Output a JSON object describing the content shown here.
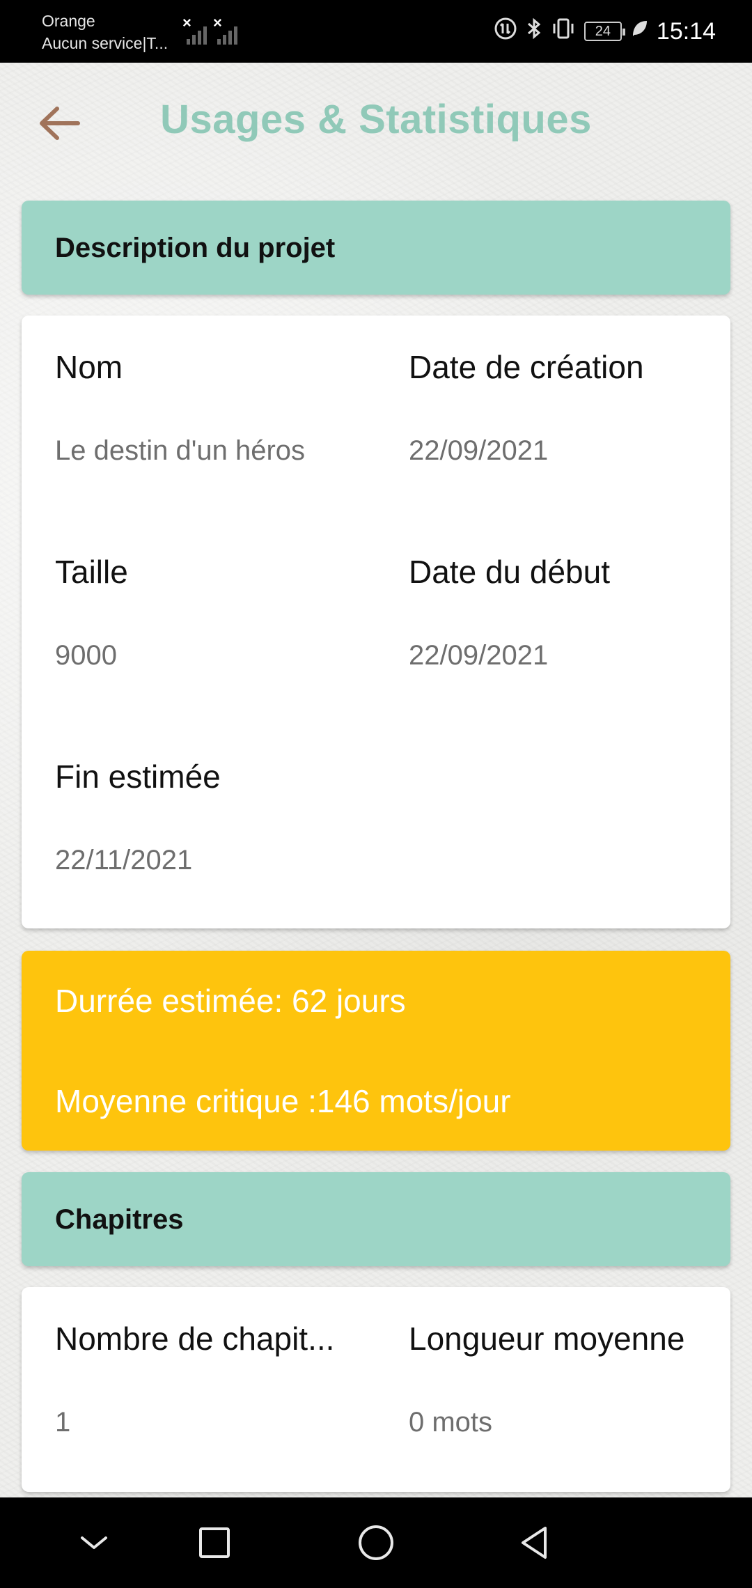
{
  "status_bar": {
    "carrier_name": "Orange",
    "carrier_status": "Aucun service|T...",
    "battery_level": "24",
    "time": "15:14",
    "icons": [
      "signal-no-service-icon",
      "signal-no-service-icon",
      "data-icon",
      "bluetooth-icon",
      "vibrate-icon",
      "battery-icon",
      "leaf-icon"
    ]
  },
  "header": {
    "title": "Usages & Statistiques",
    "back_icon": "arrow-left-icon"
  },
  "project_section": {
    "title": "Description du projet",
    "fields": {
      "name_label": "Nom",
      "name_value": "Le destin d'un héros",
      "creation_label": "Date de création",
      "creation_value": "22/09/2021",
      "size_label": "Taille",
      "size_value": "9000",
      "start_label": "Date du début",
      "start_value": "22/09/2021",
      "end_label": "Fin estimée",
      "end_value": "22/11/2021"
    }
  },
  "estimate_card": {
    "duration": "Durrée estimée: 62 jours",
    "average": "Moyenne critique :146 mots/jour"
  },
  "chapters_section": {
    "title": "Chapitres",
    "fields": {
      "count_label": "Nombre de chapit...",
      "count_value": "1",
      "avg_length_label": "Longueur moyenne",
      "avg_length_value": "0 mots"
    }
  },
  "nav_bar": {
    "icons": [
      "chevron-down-icon",
      "recents-square-icon",
      "home-circle-icon",
      "back-triangle-icon"
    ]
  },
  "colors": {
    "title": "#90c9b8",
    "section_header": "#9dd5c6",
    "estimate_card": "#fec40d",
    "back_arrow": "#a0735a"
  }
}
